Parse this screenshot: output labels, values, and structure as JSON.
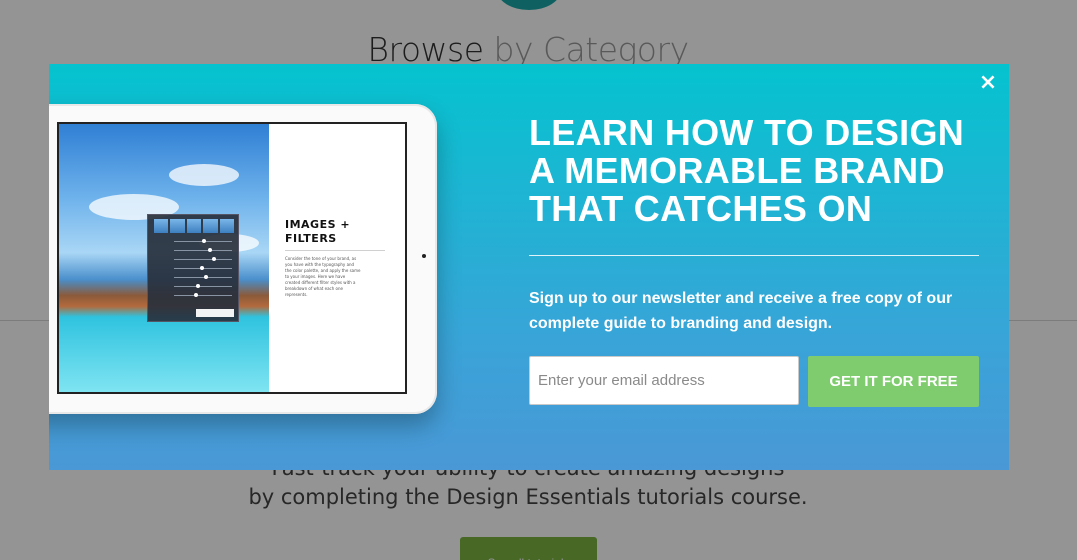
{
  "background": {
    "heading_main": "Browse",
    "heading_light": "by Category",
    "text_line1": "Fast-track your ability to create amazing designs",
    "text_line2": "by completing the Design Essentials tutorials course.",
    "button_label": "See all tutorials"
  },
  "modal": {
    "close_label": "×",
    "headline": "LEARN HOW TO DESIGN A MEMORABLE BRAND THAT CATCHES ON",
    "subtext": "Sign up to our newsletter and receive a free copy of our complete guide to branding and design.",
    "email_placeholder": "Enter your email address",
    "email_value": "",
    "cta_label": "GET IT FOR FREE",
    "tablet": {
      "side_title": "IMAGES + FILTERS",
      "side_body": "Consider the tone of your brand, as you have with the typography and the color palette, and apply the same to your images. Here we have created different filter styles with a breakdown of what each one represents."
    }
  },
  "colors": {
    "modal_top": "#05c3cf",
    "modal_bottom": "#4a98d6",
    "cta": "#7fcc6e",
    "bg_button": "#7cb342",
    "overlay": "rgba(0,0,0,0.42)"
  },
  "icons": {
    "close": "close-icon"
  }
}
